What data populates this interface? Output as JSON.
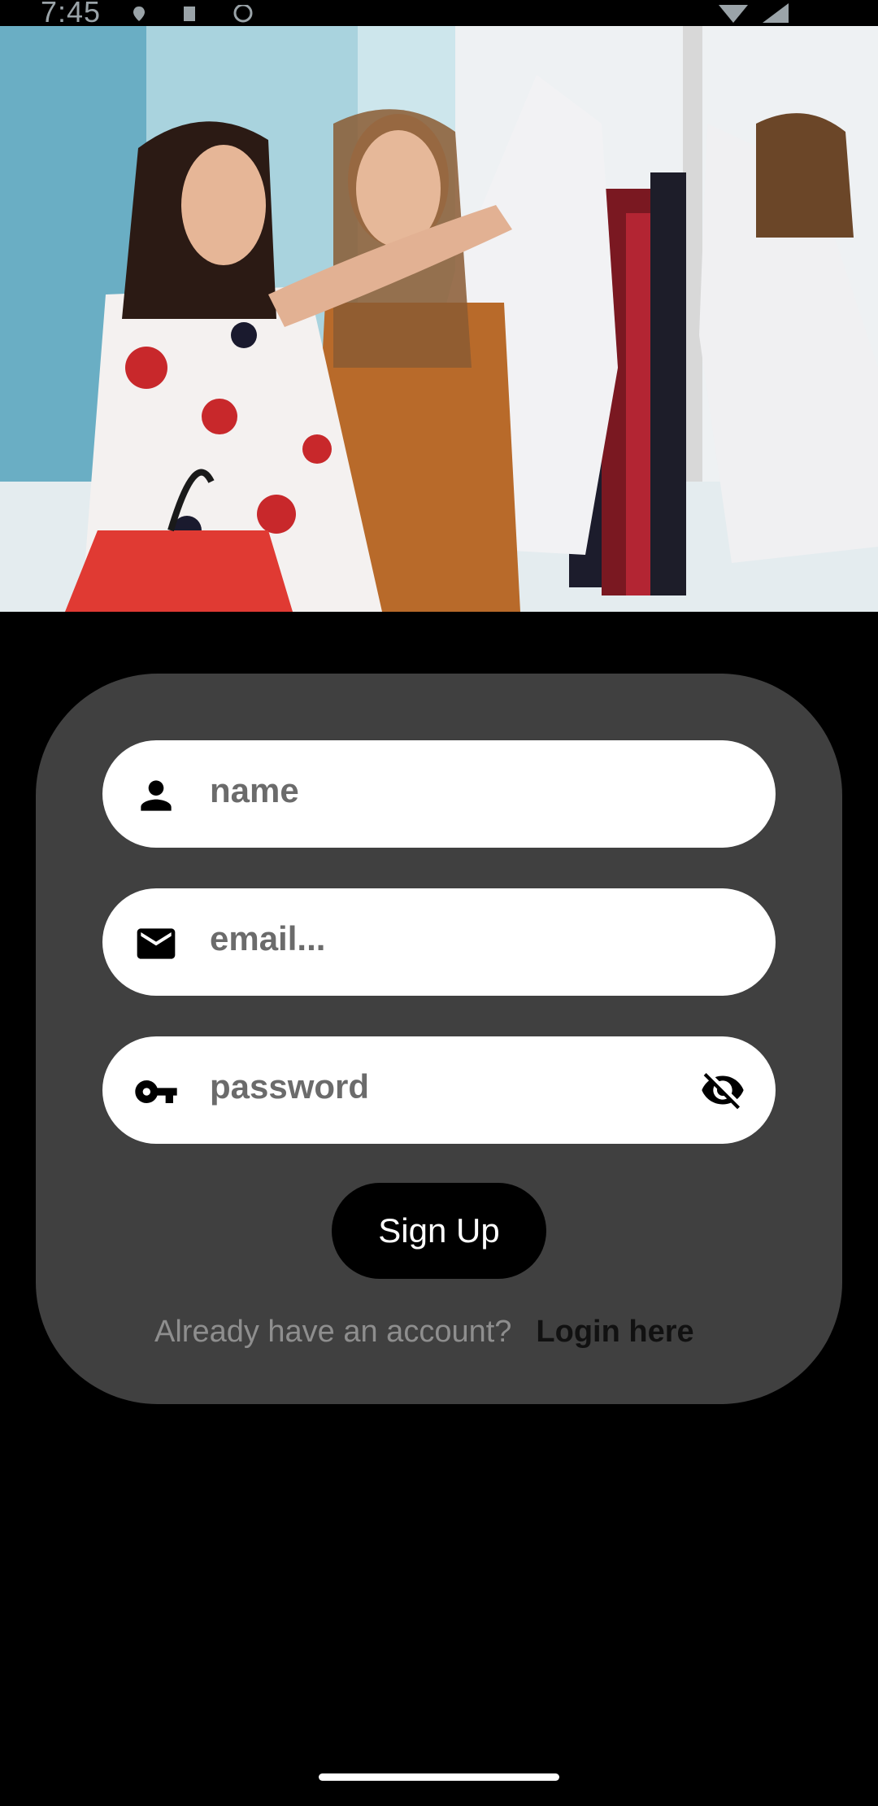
{
  "status_bar": {
    "time": "7:45"
  },
  "hero": {
    "image_description_icon": "shopping-photo"
  },
  "form": {
    "name_placeholder": "name",
    "email_placeholder": "email...",
    "password_placeholder": "password",
    "signup_label": "Sign Up",
    "login_prompt": "Already have an account?",
    "login_link": "Login here"
  },
  "icons": {
    "name": "person-icon",
    "email": "mail-icon",
    "password": "key-icon",
    "visibility": "eye-off-icon"
  },
  "colors": {
    "background": "#000000",
    "card": "#404040",
    "field": "#ffffff",
    "button": "#000000"
  }
}
